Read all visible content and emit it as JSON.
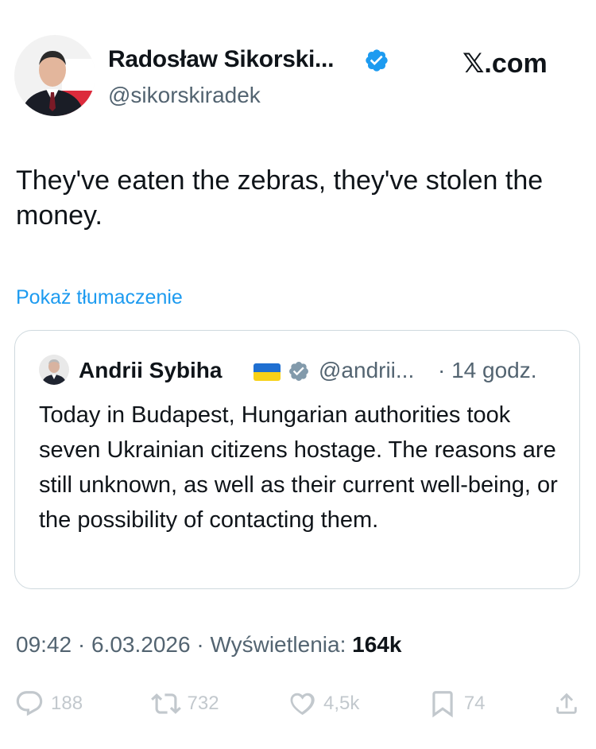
{
  "author": {
    "name": "Radosław Sikorski...",
    "handle": "@sikorskiradek",
    "verified_color": "#1d9bf0"
  },
  "brand": {
    "logo": "𝕏.com"
  },
  "tweet": {
    "text": "They've eaten the zebras, they've stolen the money.",
    "translate_label": "Pokaż tłumaczenie"
  },
  "quoted": {
    "name": "Andrii Sybiha",
    "flag_icon": "ukraine-flag-icon",
    "verified_color": "#829aab",
    "handle": "@andrii...",
    "time": "· 14 godz.",
    "text": "Today in Budapest, Hungarian authorities took seven Ukrainian citizens hostage. The reasons are still unknown, as well as their current well-being, or the possibility of contacting them."
  },
  "meta": {
    "time": "09:42",
    "date": "6.03.2026",
    "views_label": "Wyświetlenia:",
    "views": "164k"
  },
  "actions": {
    "replies": "188",
    "reposts": "732",
    "likes": "4,5k",
    "bookmarks": "74"
  }
}
